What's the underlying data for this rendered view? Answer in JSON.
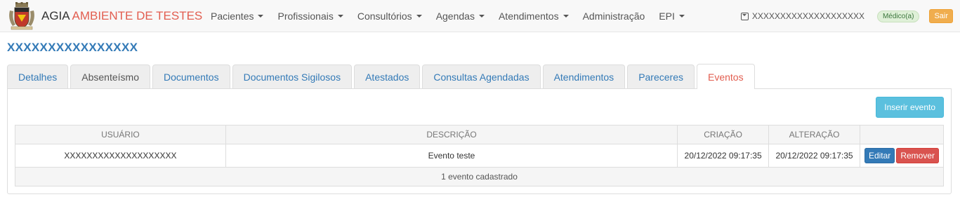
{
  "navbar": {
    "brand_name": "AGIA",
    "brand_env": "AMBIENTE DE TESTES",
    "menu": [
      {
        "label": "Pacientes",
        "dropdown": true
      },
      {
        "label": "Profissionais",
        "dropdown": true
      },
      {
        "label": "Consultórios",
        "dropdown": true
      },
      {
        "label": "Agendas",
        "dropdown": true
      },
      {
        "label": "Atendimentos",
        "dropdown": true
      },
      {
        "label": "Administração",
        "dropdown": false
      },
      {
        "label": "EPI",
        "dropdown": true
      }
    ],
    "user_name": "XXXXXXXXXXXXXXXXXXXX",
    "role_badge": "Médico(a)",
    "logout_label": "Sair"
  },
  "page": {
    "title": "XXXXXXXXXXXXXXXX",
    "tabs": [
      {
        "label": "Detalhes",
        "state": "normal"
      },
      {
        "label": "Absenteísmo",
        "state": "muted"
      },
      {
        "label": "Documentos",
        "state": "normal"
      },
      {
        "label": "Documentos Sigilosos",
        "state": "normal"
      },
      {
        "label": "Atestados",
        "state": "normal"
      },
      {
        "label": "Consultas Agendadas",
        "state": "normal"
      },
      {
        "label": "Atendimentos",
        "state": "normal"
      },
      {
        "label": "Pareceres",
        "state": "normal"
      },
      {
        "label": "Eventos",
        "state": "active"
      }
    ],
    "insert_button": "Inserir evento"
  },
  "table": {
    "columns": [
      "USUÁRIO",
      "DESCRIÇÃO",
      "CRIAÇÃO",
      "ALTERAÇÃO",
      ""
    ],
    "rows": [
      {
        "usuario": "XXXXXXXXXXXXXXXXXXXX",
        "descricao": "Evento teste",
        "criacao": "20/12/2022 09:17:35",
        "alteracao": "20/12/2022 09:17:35",
        "edit_label": "Editar",
        "remove_label": "Remover"
      }
    ],
    "footer": "1 evento cadastrado"
  },
  "colors": {
    "brand_accent": "#e25d4f",
    "link_blue": "#337ab7",
    "info_button": "#5bc0de",
    "danger_button": "#d9534f",
    "warning_button": "#f0ad4e"
  }
}
